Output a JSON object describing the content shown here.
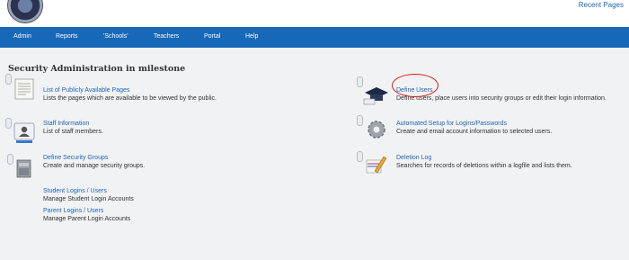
{
  "header": {
    "recent_pages": "Recent Pages"
  },
  "nav": [
    "Admin",
    "Reports",
    "'Schools'",
    "Teachers",
    "Portal",
    "Help"
  ],
  "page": {
    "title": "Security Administration in milestone"
  },
  "left": [
    {
      "link": "List of Publicly Available Pages",
      "desc": "Lists the pages which are available to be viewed by the public."
    },
    {
      "link": "Staff Information",
      "desc": "List of staff members."
    },
    {
      "link": "Define Security Groups",
      "desc": "Create and manage security groups."
    },
    {
      "link": "Student Logins / Users",
      "desc": "Manage Student Login Accounts"
    },
    {
      "link": "Parent Logins / Users",
      "desc": "Manage Parent Login Accounts"
    }
  ],
  "right": [
    {
      "link": "Define Users",
      "desc": "Define users, place users into security groups or edit their login information."
    },
    {
      "link": "Automated Setup for Logins/Passwords",
      "desc": "Create and email account information to selected users."
    },
    {
      "link": "Deletion Log",
      "desc": "Searches for records of deletions within a logfile and lists them."
    }
  ],
  "colors": {
    "nav_bg": "#1768b8",
    "link": "#1f65b5",
    "content_bg": "#f1f2f4",
    "highlight_circle": "#d41e1e"
  }
}
